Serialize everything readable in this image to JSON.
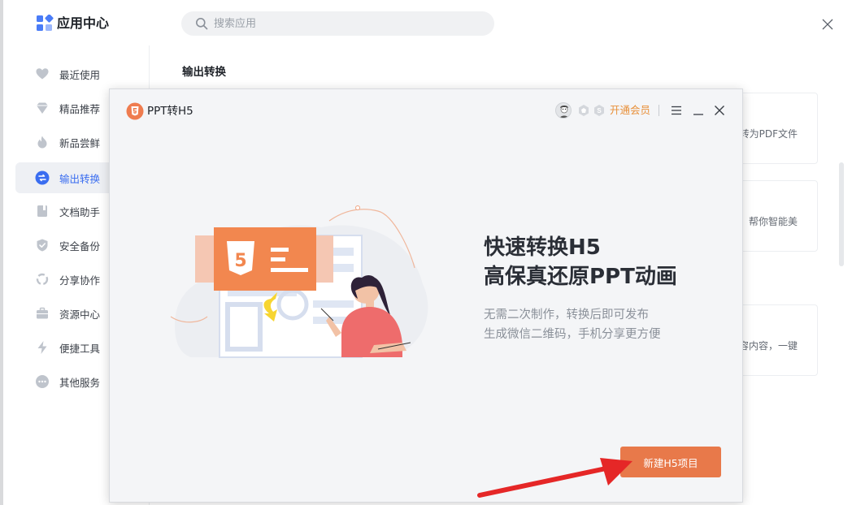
{
  "app": {
    "title": "应用中心",
    "search_placeholder": "搜索应用"
  },
  "sidebar": {
    "items": [
      {
        "label": "最近使用",
        "icon": "heart-icon"
      },
      {
        "label": "精品推荐",
        "icon": "gem-icon"
      },
      {
        "label": "新品尝鲜",
        "icon": "flame-icon"
      },
      {
        "label": "输出转换",
        "icon": "convert-icon",
        "active": true
      },
      {
        "label": "文档助手",
        "icon": "book-icon"
      },
      {
        "label": "安全备份",
        "icon": "shield-icon"
      },
      {
        "label": "分享协作",
        "icon": "share-icon"
      },
      {
        "label": "资源中心",
        "icon": "briefcase-icon"
      },
      {
        "label": "便捷工具",
        "icon": "lightning-icon"
      },
      {
        "label": "其他服务",
        "icon": "more-icon"
      }
    ]
  },
  "main": {
    "section_title": "输出转换",
    "cards": [
      {
        "text": "转为PDF文件"
      },
      {
        "text": "帮你智能美"
      },
      {
        "text": "容内容，一键"
      }
    ]
  },
  "dialog": {
    "title": "PPT转H5",
    "vip_label": "开通会员",
    "headline_line1": "快速转换H5",
    "headline_line2": "高保真还原PPT动画",
    "desc_line1": "无需二次制作，转换后即可发布",
    "desc_line2": "生成微信二维码，手机分享更方便",
    "primary_button": "新建H5项目",
    "illustration_badge": "5"
  },
  "colors": {
    "accent_blue": "#3a6df0",
    "orange": "#e8794a",
    "vip_orange": "#e8903a",
    "annotation_red": "#e52727"
  }
}
